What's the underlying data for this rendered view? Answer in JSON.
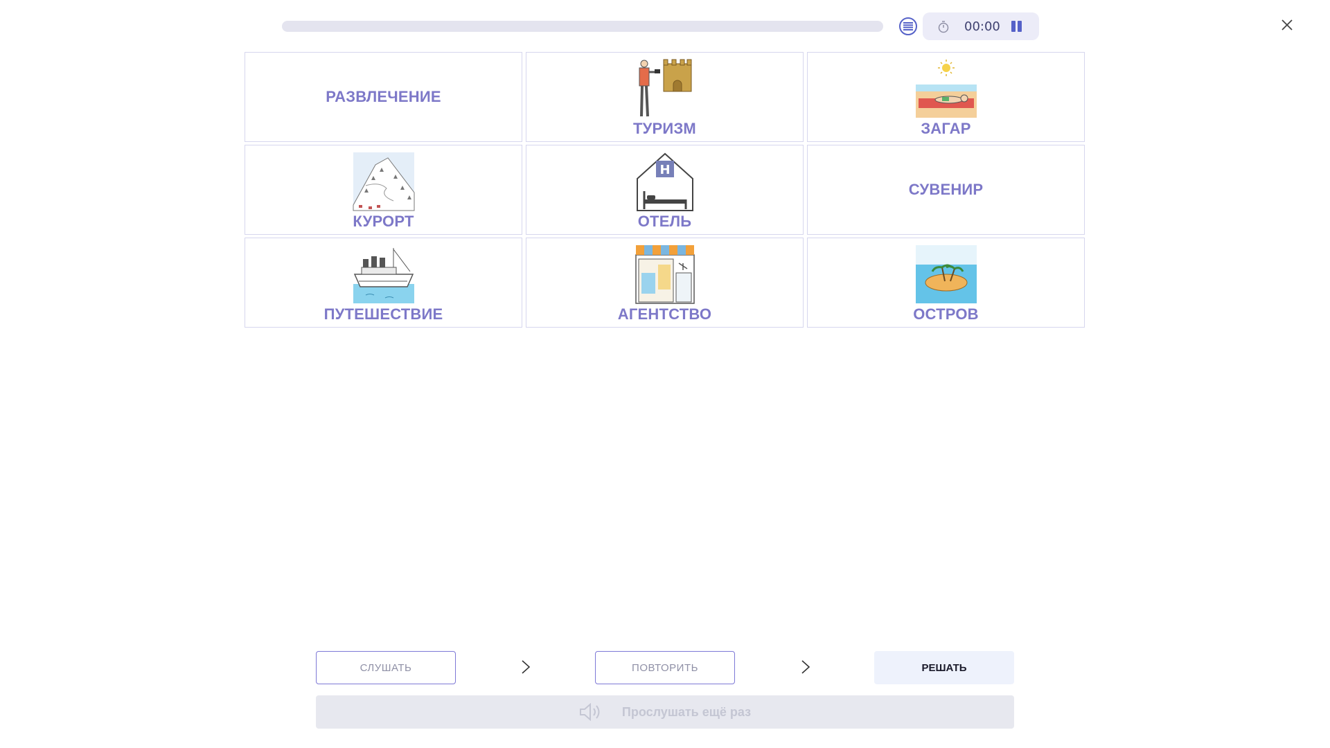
{
  "header": {
    "progress": 0,
    "timer": "00:00"
  },
  "cards": [
    {
      "label": "РАЗВЛЕЧЕНИЕ",
      "icon": "none"
    },
    {
      "label": "ТУРИЗМ",
      "icon": "tourist-castle-image"
    },
    {
      "label": "ЗАГАР",
      "icon": "sunbathing-image"
    },
    {
      "label": "КУРОРТ",
      "icon": "ski-resort-image"
    },
    {
      "label": "ОТЕЛЬ",
      "icon": "hotel-image"
    },
    {
      "label": "СУВЕНИР",
      "icon": "none"
    },
    {
      "label": "ПУТЕШЕСТВИЕ",
      "icon": "ship-image"
    },
    {
      "label": "АГЕНТСТВО",
      "icon": "travel-agency-image"
    },
    {
      "label": "ОСТРОВ",
      "icon": "island-image"
    }
  ],
  "controls": {
    "listen": "СЛУШАТЬ",
    "repeat": "ПОВТОРИТЬ",
    "solve": "РЕШАТЬ",
    "listen_again": "Прослушать ещё раз"
  },
  "colors": {
    "accent": "#5561c8",
    "card_label": "#7d78c8",
    "card_border": "#d6d6ee"
  }
}
